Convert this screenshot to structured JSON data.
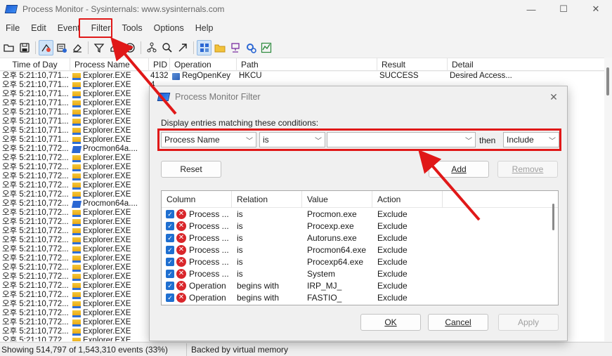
{
  "window": {
    "title": "Process Monitor - Sysinternals: www.sysinternals.com",
    "minimize": "—",
    "maximize": "☐",
    "close": "✕"
  },
  "menu": [
    "File",
    "Edit",
    "Event",
    "Filter",
    "Tools",
    "Options",
    "Help"
  ],
  "columns": [
    "Time of Day",
    "Process Name",
    "PID",
    "Operation",
    "Path",
    "Result",
    "Detail"
  ],
  "rows": [
    {
      "time": "오후 5:21:10,771...",
      "proc": "Explorer.EXE",
      "icon": "explorer",
      "pid": "4132",
      "op": "RegOpenKey",
      "path": "HKCU",
      "result": "SUCCESS",
      "detail": "Desired Access..."
    },
    {
      "time": "오후 5:21:10,771...",
      "proc": "Explorer.EXE",
      "icon": "explorer",
      "pid": "4",
      "op": "",
      "path": "",
      "result": "",
      "detail": ""
    },
    {
      "time": "오후 5:21:10,771...",
      "proc": "Explorer.EXE",
      "icon": "explorer",
      "pid": "4",
      "op": "",
      "path": "",
      "result": "",
      "detail": ""
    },
    {
      "time": "오후 5:21:10,771...",
      "proc": "Explorer.EXE",
      "icon": "explorer",
      "pid": "4",
      "op": "",
      "path": "",
      "result": "",
      "detail": ""
    },
    {
      "time": "오후 5:21:10,771...",
      "proc": "Explorer.EXE",
      "icon": "explorer",
      "pid": "4",
      "op": "",
      "path": "",
      "result": "",
      "detail": ""
    },
    {
      "time": "오후 5:21:10,771...",
      "proc": "Explorer.EXE",
      "icon": "explorer",
      "pid": "4",
      "op": "",
      "path": "",
      "result": "",
      "detail": ""
    },
    {
      "time": "오후 5:21:10,771...",
      "proc": "Explorer.EXE",
      "icon": "explorer",
      "pid": "4",
      "op": "",
      "path": "",
      "result": "",
      "detail": ""
    },
    {
      "time": "오후 5:21:10,771...",
      "proc": "Explorer.EXE",
      "icon": "explorer",
      "pid": "4",
      "op": "",
      "path": "",
      "result": "",
      "detail": ""
    },
    {
      "time": "오후 5:21:10,772...",
      "proc": "Procmon64a....",
      "icon": "procmon",
      "pid": "8",
      "op": "",
      "path": "",
      "result": "",
      "detail": ""
    },
    {
      "time": "오후 5:21:10,772...",
      "proc": "Explorer.EXE",
      "icon": "explorer",
      "pid": "4",
      "op": "",
      "path": "",
      "result": "",
      "detail": ""
    },
    {
      "time": "오후 5:21:10,772...",
      "proc": "Explorer.EXE",
      "icon": "explorer",
      "pid": "4",
      "op": "",
      "path": "",
      "result": "",
      "detail": ""
    },
    {
      "time": "오후 5:21:10,772...",
      "proc": "Explorer.EXE",
      "icon": "explorer",
      "pid": "4",
      "op": "",
      "path": "",
      "result": "",
      "detail": ""
    },
    {
      "time": "오후 5:21:10,772...",
      "proc": "Explorer.EXE",
      "icon": "explorer",
      "pid": "4",
      "op": "",
      "path": "",
      "result": "",
      "detail": ""
    },
    {
      "time": "오후 5:21:10,772...",
      "proc": "Explorer.EXE",
      "icon": "explorer",
      "pid": "4",
      "op": "",
      "path": "",
      "result": "",
      "detail": ""
    },
    {
      "time": "오후 5:21:10,772...",
      "proc": "Procmon64a....",
      "icon": "procmon",
      "pid": "8",
      "op": "",
      "path": "",
      "result": "",
      "detail": ""
    },
    {
      "time": "오후 5:21:10,772...",
      "proc": "Explorer.EXE",
      "icon": "explorer",
      "pid": "4",
      "op": "",
      "path": "",
      "result": "",
      "detail": ""
    },
    {
      "time": "오후 5:21:10,772...",
      "proc": "Explorer.EXE",
      "icon": "explorer",
      "pid": "4",
      "op": "",
      "path": "",
      "result": "",
      "detail": ""
    },
    {
      "time": "오후 5:21:10,772...",
      "proc": "Explorer.EXE",
      "icon": "explorer",
      "pid": "4",
      "op": "",
      "path": "",
      "result": "",
      "detail": ""
    },
    {
      "time": "오후 5:21:10,772...",
      "proc": "Explorer.EXE",
      "icon": "explorer",
      "pid": "4",
      "op": "",
      "path": "",
      "result": "",
      "detail": ""
    },
    {
      "time": "오후 5:21:10,772...",
      "proc": "Explorer.EXE",
      "icon": "explorer",
      "pid": "4",
      "op": "",
      "path": "",
      "result": "",
      "detail": ""
    },
    {
      "time": "오후 5:21:10,772...",
      "proc": "Explorer.EXE",
      "icon": "explorer",
      "pid": "4",
      "op": "",
      "path": "",
      "result": "",
      "detail": ""
    },
    {
      "time": "오후 5:21:10,772...",
      "proc": "Explorer.EXE",
      "icon": "explorer",
      "pid": "4",
      "op": "",
      "path": "",
      "result": "",
      "detail": ""
    },
    {
      "time": "오후 5:21:10,772...",
      "proc": "Explorer.EXE",
      "icon": "explorer",
      "pid": "4",
      "op": "",
      "path": "",
      "result": "",
      "detail": ""
    },
    {
      "time": "오후 5:21:10,772...",
      "proc": "Explorer.EXE",
      "icon": "explorer",
      "pid": "4",
      "op": "",
      "path": "",
      "result": "",
      "detail": ""
    },
    {
      "time": "오후 5:21:10,772...",
      "proc": "Explorer.EXE",
      "icon": "explorer",
      "pid": "4",
      "op": "",
      "path": "",
      "result": "",
      "detail": ""
    },
    {
      "time": "오후 5:21:10,772...",
      "proc": "Explorer.EXE",
      "icon": "explorer",
      "pid": "4",
      "op": "",
      "path": "",
      "result": "",
      "detail": ""
    },
    {
      "time": "오후 5:21:10,772...",
      "proc": "Explorer.EXE",
      "icon": "explorer",
      "pid": "4",
      "op": "",
      "path": "",
      "result": "",
      "detail": ""
    },
    {
      "time": "오후 5:21:10,772...",
      "proc": "Explorer.EXE",
      "icon": "explorer",
      "pid": "4",
      "op": "",
      "path": "",
      "result": "",
      "detail": ""
    },
    {
      "time": "오후 5:21:10,772...",
      "proc": "Explorer.EXE",
      "icon": "explorer",
      "pid": "4",
      "op": "",
      "path": "",
      "result": "",
      "detail": ""
    },
    {
      "time": "오후 5:21:10,772...",
      "proc": "Explorer.EXE",
      "icon": "explorer",
      "pid": "4",
      "op": "",
      "path": "",
      "result": "",
      "detail": ""
    }
  ],
  "status": {
    "events": "Showing 514,797 of 1,543,310 events (33%)",
    "memory": "Backed by virtual memory"
  },
  "dialog": {
    "title": "Process Monitor Filter",
    "prompt": "Display entries matching these conditions:",
    "column_value": "Process Name",
    "relation_value": "is",
    "value_value": "",
    "then_label": "then",
    "action_value": "Include",
    "reset_label": "Reset",
    "add_label": "Add",
    "remove_label": "Remove",
    "ok_label": "OK",
    "cancel_label": "Cancel",
    "apply_label": "Apply",
    "rule_columns": [
      "Column",
      "Relation",
      "Value",
      "Action"
    ],
    "rules": [
      {
        "column": "Process ...",
        "relation": "is",
        "value": "Procmon.exe",
        "action": "Exclude"
      },
      {
        "column": "Process ...",
        "relation": "is",
        "value": "Procexp.exe",
        "action": "Exclude"
      },
      {
        "column": "Process ...",
        "relation": "is",
        "value": "Autoruns.exe",
        "action": "Exclude"
      },
      {
        "column": "Process ...",
        "relation": "is",
        "value": "Procmon64.exe",
        "action": "Exclude"
      },
      {
        "column": "Process ...",
        "relation": "is",
        "value": "Procexp64.exe",
        "action": "Exclude"
      },
      {
        "column": "Process ...",
        "relation": "is",
        "value": "System",
        "action": "Exclude"
      },
      {
        "column": "Operation",
        "relation": "begins with",
        "value": "IRP_MJ_",
        "action": "Exclude"
      },
      {
        "column": "Operation",
        "relation": "begins with",
        "value": "FASTIO_",
        "action": "Exclude"
      }
    ]
  },
  "colors": {
    "highlight": "#e01818",
    "accent": "#1f6fd0",
    "exclude_icon": "#d9262b"
  },
  "icons": [
    "open-icon",
    "save-icon",
    "capture-icon",
    "autoscroll-icon",
    "clear-icon",
    "filter-icon",
    "highlight-icon",
    "target-icon",
    "tree-icon",
    "find-icon",
    "jump-icon",
    "registry-icon",
    "filesystem-icon",
    "network-icon",
    "process-icon",
    "profiling-icon"
  ]
}
